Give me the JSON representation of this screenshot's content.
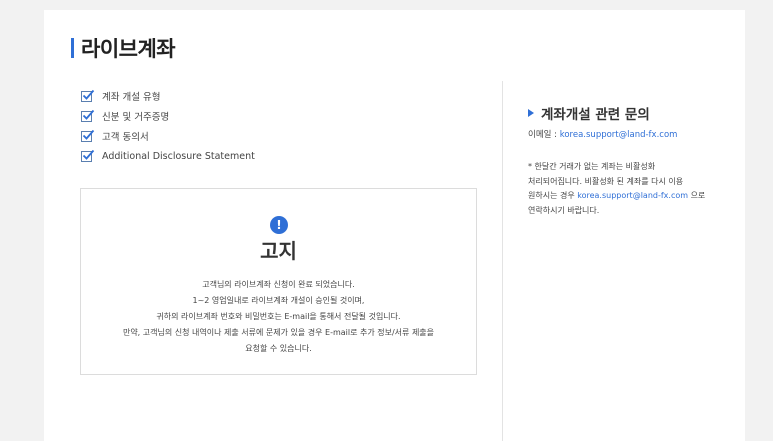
{
  "page": {
    "title": "라이브계좌"
  },
  "checklist": [
    {
      "label": "계좌 개설 유형"
    },
    {
      "label": "신분 및 거주증명"
    },
    {
      "label": "고객 동의서"
    },
    {
      "label": "Additional Disclosure Statement"
    }
  ],
  "notice": {
    "icon": "exclamation-icon",
    "icon_glyph": "!",
    "title": "고지",
    "lines": [
      "고객님의 라이브계좌 신청이 완료 되었습니다.",
      "1~2 영업일내로 라이브계좌 개설이 승인될 것이며,",
      "귀하의 라이브계좌 번호와 비밀번호는 E-mail을 통해서 전달될 것입니다.",
      "만약, 고객님의 신청 내역이나 제출 서류에 문제가 있을 경우 E-mail로 추가 정보/서류 제출을",
      "요청할 수 있습니다."
    ]
  },
  "sidebar": {
    "title": "계좌개설 관련 문의",
    "email_label": "이메일 : ",
    "email": "korea.support@land-fx.com",
    "note_line1": "* 한달간 거래가 없는 계좌는 비활성화",
    "note_line2": "처리되어집니다. 비활성화 된 계좌를 다시 이용",
    "note_line3_pre": "원하시는 경우 ",
    "note_line3_email": "korea.support@land-fx.com",
    "note_line3_post": " 으로",
    "note_line4": "연락하시기 바랍니다."
  },
  "colors": {
    "accent": "#2f6fd6",
    "background": "#f2f2f2",
    "card": "#ffffff"
  }
}
